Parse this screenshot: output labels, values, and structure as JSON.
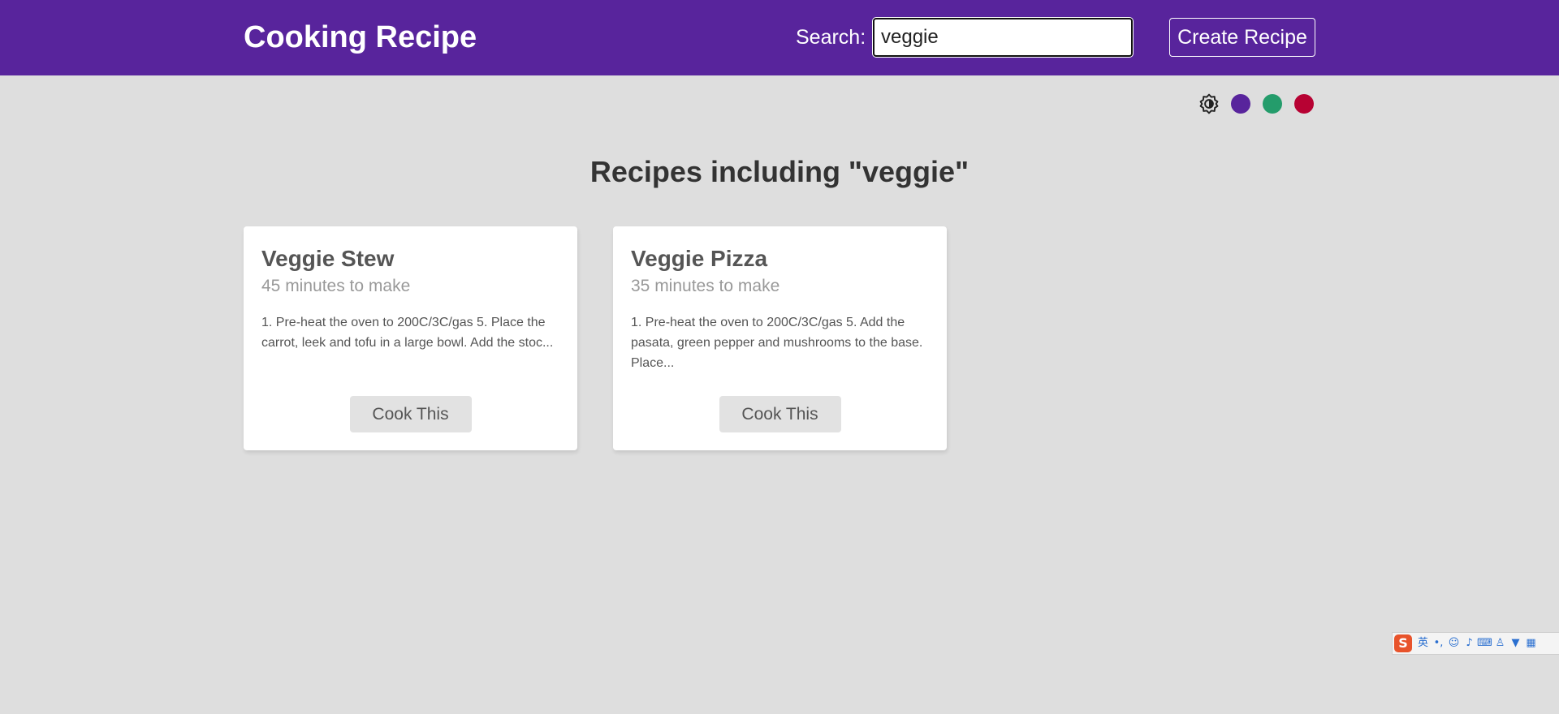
{
  "header": {
    "brand": "Cooking Recipe",
    "search_label": "Search:",
    "search_value": "veggie",
    "create_label": "Create Recipe"
  },
  "theme": {
    "mode_icon": "brightness-toggle-icon",
    "colors": [
      "#58249c",
      "#249c6b",
      "#b70233"
    ]
  },
  "main": {
    "heading": "Recipes including \"veggie\""
  },
  "recipes": [
    {
      "title": "Veggie Stew",
      "time": "45 minutes to make",
      "method": "1. Pre-heat the oven to 200C/3C/gas 5. Place the carrot, leek and tofu in a large bowl. Add the stoc...",
      "button": "Cook This"
    },
    {
      "title": "Veggie Pizza",
      "time": "35 minutes to make",
      "method": "1. Pre-heat the oven to 200C/3C/gas 5. Add the pasata, green pepper and mushrooms to the base. Place...",
      "button": "Cook This"
    }
  ],
  "ime_toolbar": {
    "logo": "S",
    "mode": "英",
    "icons": [
      "punctuation-icon",
      "emoji-icon",
      "microphone-icon",
      "keyboard-icon",
      "user-icon",
      "skin-icon",
      "toolbox-icon"
    ],
    "glyphs": [
      "•,",
      "☺",
      "♪",
      "⌨",
      "♙",
      "▼",
      "▦"
    ]
  }
}
